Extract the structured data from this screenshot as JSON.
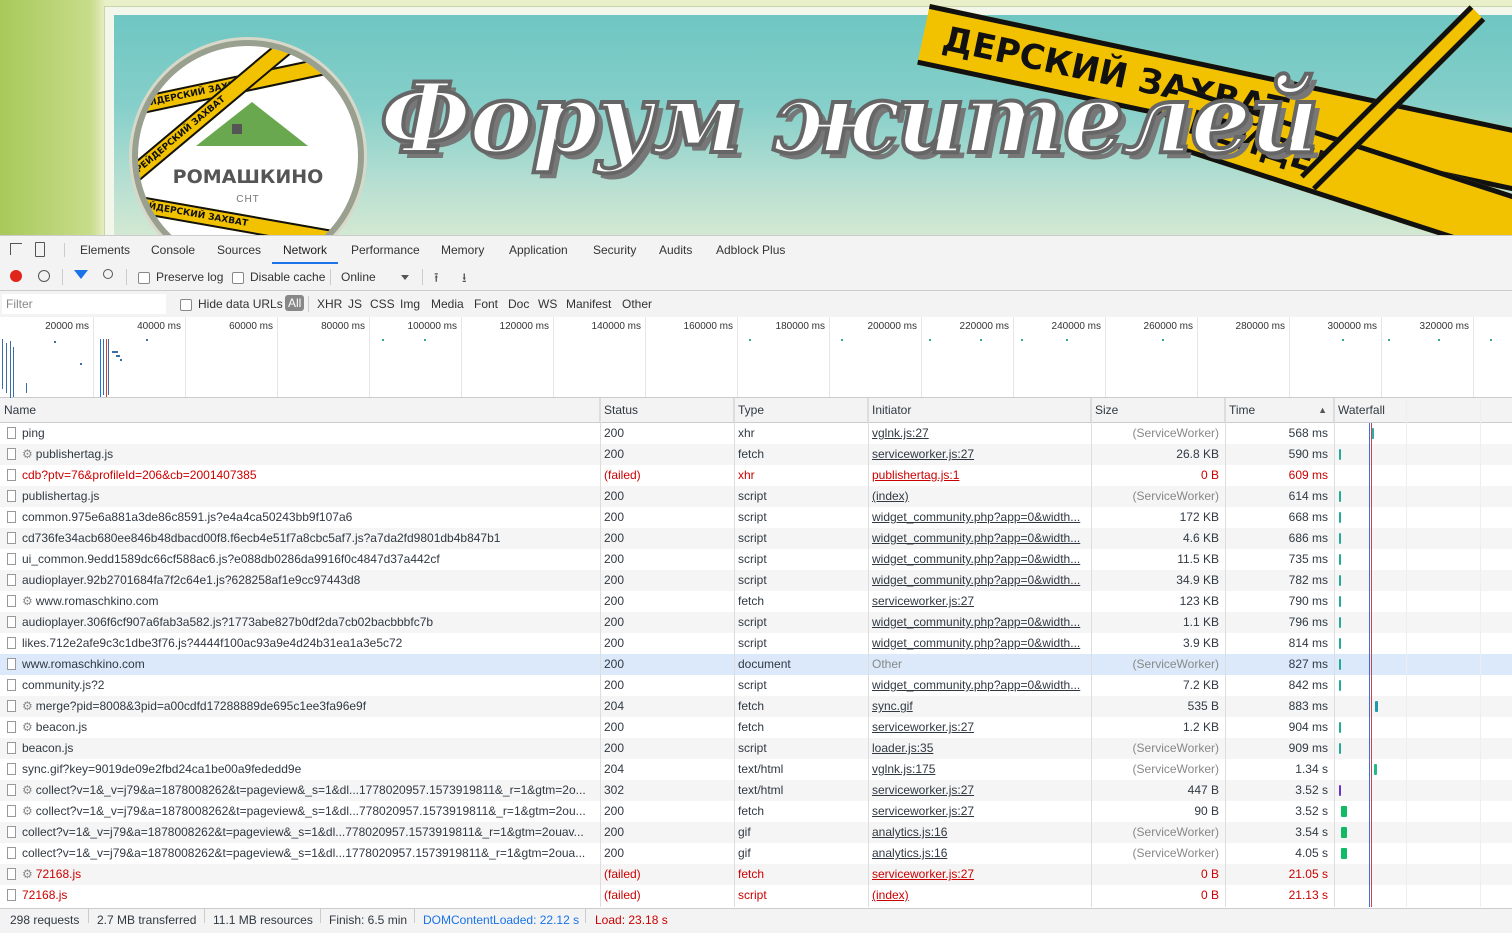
{
  "banner": {
    "title": "Форум жителей",
    "logo_name": "РОМАШКИНО",
    "logo_sub": "СНТ",
    "tape_text_small": "РЕЙДЕРСКИЙ ЗАХВАТ",
    "tape_text_big_1": "ДЕРСКИЙ ЗАХВАТ",
    "tape_text_big_2": "РЕЙДЕР",
    "tape_color": "#f2c200"
  },
  "devtools": {
    "tabs": [
      "Elements",
      "Console",
      "Sources",
      "Network",
      "Performance",
      "Memory",
      "Application",
      "Security",
      "Audits",
      "Adblock Plus"
    ],
    "active_tab": "Network",
    "toolbar": {
      "preserve_log": "Preserve log",
      "disable_cache": "Disable cache",
      "throttle": "Online"
    },
    "filterbar": {
      "filter_placeholder": "Filter",
      "hide_data_urls": "Hide data URLs",
      "types": [
        "All",
        "XHR",
        "JS",
        "CSS",
        "Img",
        "Media",
        "Font",
        "Doc",
        "WS",
        "Manifest",
        "Other"
      ],
      "active_type": "All"
    },
    "overview": {
      "labels": [
        "20000 ms",
        "40000 ms",
        "60000 ms",
        "80000 ms",
        "100000 ms",
        "120000 ms",
        "140000 ms",
        "160000 ms",
        "180000 ms",
        "200000 ms",
        "220000 ms",
        "240000 ms",
        "260000 ms",
        "280000 ms",
        "300000 ms",
        "320000 ms"
      ]
    },
    "columns": {
      "name": "Name",
      "status": "Status",
      "type": "Type",
      "initiator": "Initiator",
      "size": "Size",
      "time": "Time",
      "waterfall": "Waterfall"
    },
    "sort_indicator": "▲",
    "rows": [
      {
        "name": "ping",
        "gear": false,
        "status": "200",
        "type": "xhr",
        "initiator": "vglnk.js:27",
        "init_link": true,
        "size": "(ServiceWorker)",
        "time": "568 ms",
        "failed": false,
        "selected": false,
        "wf_color": "#3aa",
        "wf_wide": true
      },
      {
        "name": "publishertag.js",
        "gear": true,
        "status": "200",
        "type": "fetch",
        "initiator": "serviceworker.js:27",
        "init_link": true,
        "size": "26.8 KB",
        "time": "590 ms",
        "failed": false,
        "selected": false,
        "wf_color": "#2a9",
        "wf_wide": false
      },
      {
        "name": "cdb?ptv=76&profileId=206&cb=2001407385",
        "gear": false,
        "status": "(failed)",
        "type": "xhr",
        "initiator": "publishertag.js:1",
        "init_link": true,
        "size": "0 B",
        "time": "609 ms",
        "failed": true,
        "selected": false,
        "wf_color": "",
        "wf_wide": false
      },
      {
        "name": "publishertag.js",
        "gear": false,
        "status": "200",
        "type": "script",
        "initiator": "(index)",
        "init_link": true,
        "size": "(ServiceWorker)",
        "time": "614 ms",
        "failed": false,
        "selected": false,
        "wf_color": "#2a9",
        "wf_wide": false
      },
      {
        "name": "common.975e6a881a3de86c8591.js?e4a4ca50243bb9f107a6",
        "gear": false,
        "status": "200",
        "type": "script",
        "initiator": "widget_community.php?app=0&width...",
        "init_link": true,
        "size": "172 KB",
        "time": "668 ms",
        "failed": false,
        "selected": false,
        "wf_color": "#2a9",
        "wf_wide": false
      },
      {
        "name": "cd736fe34acb680ee846b48dbacd00f8.f6ecb4e51f7a8cbc5af7.js?a7da2fd9801db4b847b1",
        "gear": false,
        "status": "200",
        "type": "script",
        "initiator": "widget_community.php?app=0&width...",
        "init_link": true,
        "size": "4.6 KB",
        "time": "686 ms",
        "failed": false,
        "selected": false,
        "wf_color": "#2a9",
        "wf_wide": false
      },
      {
        "name": "ui_common.9edd1589dc66cf588ac6.js?e088db0286da9916f0c4847d37a442cf",
        "gear": false,
        "status": "200",
        "type": "script",
        "initiator": "widget_community.php?app=0&width...",
        "init_link": true,
        "size": "11.5 KB",
        "time": "735 ms",
        "failed": false,
        "selected": false,
        "wf_color": "#2a9",
        "wf_wide": false
      },
      {
        "name": "audioplayer.92b2701684fa7f2c64e1.js?628258af1e9cc97443d8",
        "gear": false,
        "status": "200",
        "type": "script",
        "initiator": "widget_community.php?app=0&width...",
        "init_link": true,
        "size": "34.9 KB",
        "time": "782 ms",
        "failed": false,
        "selected": false,
        "wf_color": "#2a9",
        "wf_wide": false
      },
      {
        "name": "www.romaschkino.com",
        "gear": true,
        "status": "200",
        "type": "fetch",
        "initiator": "serviceworker.js:27",
        "init_link": true,
        "size": "123 KB",
        "time": "790 ms",
        "failed": false,
        "selected": false,
        "wf_color": "#2a9",
        "wf_wide": false
      },
      {
        "name": "audioplayer.306f6cf907a6fab3a582.js?1773abe827b0df2da7cb02bacbbbfc7b",
        "gear": false,
        "status": "200",
        "type": "script",
        "initiator": "widget_community.php?app=0&width...",
        "init_link": true,
        "size": "1.1 KB",
        "time": "796 ms",
        "failed": false,
        "selected": false,
        "wf_color": "#2a9",
        "wf_wide": false
      },
      {
        "name": "likes.712e2afe9c3c1dbe3f76.js?4444f100ac93a9e4d24b31ea1a3e5c72",
        "gear": false,
        "status": "200",
        "type": "script",
        "initiator": "widget_community.php?app=0&width...",
        "init_link": true,
        "size": "3.9 KB",
        "time": "814 ms",
        "failed": false,
        "selected": false,
        "wf_color": "#2a9",
        "wf_wide": false
      },
      {
        "name": "www.romaschkino.com",
        "gear": false,
        "status": "200",
        "type": "document",
        "initiator": "Other",
        "init_link": false,
        "size": "(ServiceWorker)",
        "time": "827 ms",
        "failed": false,
        "selected": true,
        "wf_color": "#2a9",
        "wf_wide": false
      },
      {
        "name": "community.js?2",
        "gear": false,
        "status": "200",
        "type": "script",
        "initiator": "widget_community.php?app=0&width...",
        "init_link": true,
        "size": "7.2 KB",
        "time": "842 ms",
        "failed": false,
        "selected": false,
        "wf_color": "#2a9",
        "wf_wide": false
      },
      {
        "name": "merge?pid=8008&3pid=a00cdfd17288889de695c1ee3fa96e9f",
        "gear": true,
        "status": "204",
        "type": "fetch",
        "initiator": "sync.gif",
        "init_link": true,
        "size": "535 B",
        "time": "883 ms",
        "failed": false,
        "selected": false,
        "wf_color": "#29a",
        "wf_wide": false
      },
      {
        "name": "beacon.js",
        "gear": true,
        "status": "200",
        "type": "fetch",
        "initiator": "serviceworker.js:27",
        "init_link": true,
        "size": "1.2 KB",
        "time": "904 ms",
        "failed": false,
        "selected": false,
        "wf_color": "#2a9",
        "wf_wide": false
      },
      {
        "name": "beacon.js",
        "gear": false,
        "status": "200",
        "type": "script",
        "initiator": "loader.js:35",
        "init_link": true,
        "size": "(ServiceWorker)",
        "time": "909 ms",
        "failed": false,
        "selected": false,
        "wf_color": "#2a9",
        "wf_wide": false
      },
      {
        "name": "sync.gif?key=9019de09e2fbd24ca1be00a9fededd9e",
        "gear": false,
        "status": "204",
        "type": "text/html",
        "initiator": "vglnk.js:175",
        "init_link": true,
        "size": "(ServiceWorker)",
        "time": "1.34 s",
        "failed": false,
        "selected": false,
        "wf_color": "#2b8",
        "wf_wide": false
      },
      {
        "name": "collect?v=1&_v=j79&a=1878008262&t=pageview&_s=1&dl...1778020957.1573919811&_r=1&gtm=2o...",
        "gear": true,
        "status": "302",
        "type": "text/html",
        "initiator": "serviceworker.js:27",
        "init_link": true,
        "size": "447 B",
        "time": "3.52 s",
        "failed": false,
        "selected": false,
        "wf_color": "#63c",
        "wf_wide": false
      },
      {
        "name": "collect?v=1&_v=j79&a=1878008262&t=pageview&_s=1&dl...778020957.1573919811&_r=1&gtm=2ou...",
        "gear": true,
        "status": "200",
        "type": "fetch",
        "initiator": "serviceworker.js:27",
        "init_link": true,
        "size": "90 B",
        "time": "3.52 s",
        "failed": false,
        "selected": false,
        "wf_color": "#1b6",
        "wf_wide": true
      },
      {
        "name": "collect?v=1&_v=j79&a=1878008262&t=pageview&_s=1&dl...778020957.1573919811&_r=1&gtm=2ouav...",
        "gear": false,
        "status": "200",
        "type": "gif",
        "initiator": "analytics.js:16",
        "init_link": true,
        "size": "(ServiceWorker)",
        "time": "3.54 s",
        "failed": false,
        "selected": false,
        "wf_color": "#1b6",
        "wf_wide": true
      },
      {
        "name": "collect?v=1&_v=j79&a=1878008262&t=pageview&_s=1&dl...1778020957.1573919811&_r=1&gtm=2oua...",
        "gear": false,
        "status": "200",
        "type": "gif",
        "initiator": "analytics.js:16",
        "init_link": true,
        "size": "(ServiceWorker)",
        "time": "4.05 s",
        "failed": false,
        "selected": false,
        "wf_color": "#1b6",
        "wf_wide": true
      },
      {
        "name": "72168.js",
        "gear": true,
        "status": "(failed)",
        "type": "fetch",
        "initiator": "serviceworker.js:27",
        "init_link": true,
        "size": "0 B",
        "time": "21.05 s",
        "failed": true,
        "selected": false,
        "wf_color": "",
        "wf_wide": false
      },
      {
        "name": "72168.js",
        "gear": false,
        "status": "(failed)",
        "type": "script",
        "initiator": "(index)",
        "init_link": true,
        "size": "0 B",
        "time": "21.13 s",
        "failed": true,
        "selected": false,
        "wf_color": "",
        "wf_wide": false
      }
    ],
    "statusbar": {
      "requests": "298 requests",
      "transferred": "2.7 MB transferred",
      "resources": "11.1 MB resources",
      "finish": "Finish: 6.5 min",
      "domcontentloaded": "DOMContentLoaded: 22.12 s",
      "load": "Load: 23.18 s"
    },
    "colors": {
      "domcontentloaded": "#1a73e8",
      "load": "#c00",
      "record": "#e0251c",
      "failed": "#cc0000"
    }
  }
}
